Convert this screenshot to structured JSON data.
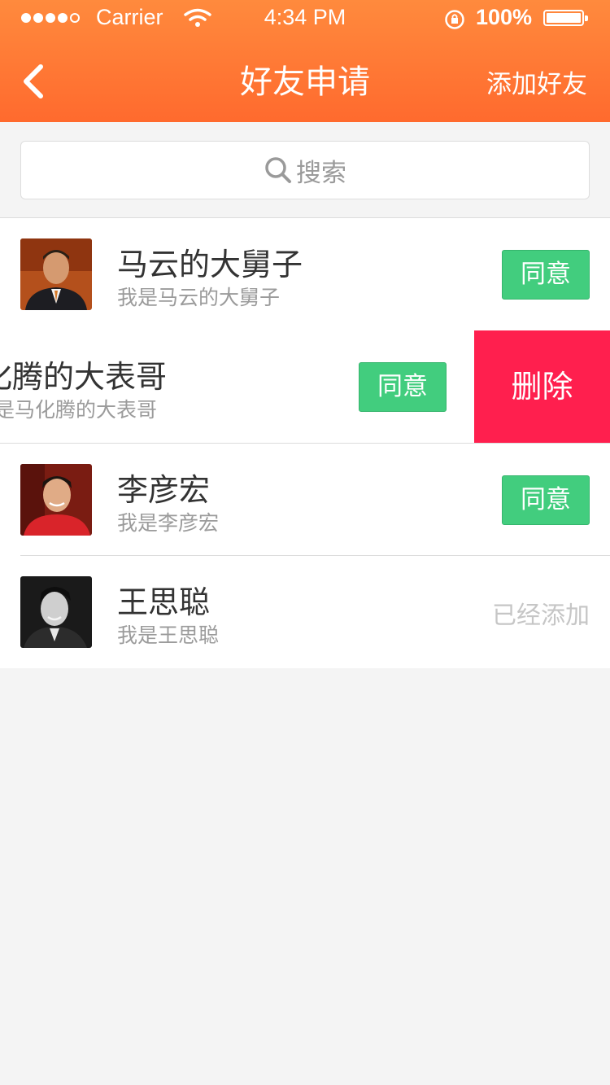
{
  "status_bar": {
    "carrier": "Carrier",
    "time": "4:34 PM",
    "battery": "100%"
  },
  "nav": {
    "title": "好友申请",
    "right_action": "添加好友"
  },
  "search": {
    "placeholder": "搜索"
  },
  "requests": [
    {
      "name": "马云的大舅子",
      "message": "我是马云的大舅子",
      "action": "同意"
    },
    {
      "name": "化腾的大表哥",
      "message": "是马化腾的大表哥",
      "action": "同意",
      "delete_label": "删除"
    },
    {
      "name": "李彦宏",
      "message": "我是李彦宏",
      "action": "同意"
    },
    {
      "name": "王思聪",
      "message": "我是王思聪",
      "status": "已经添加"
    }
  ],
  "colors": {
    "header": "#ff7733",
    "agree": "#42cd7e",
    "delete": "#ff1f4e"
  }
}
